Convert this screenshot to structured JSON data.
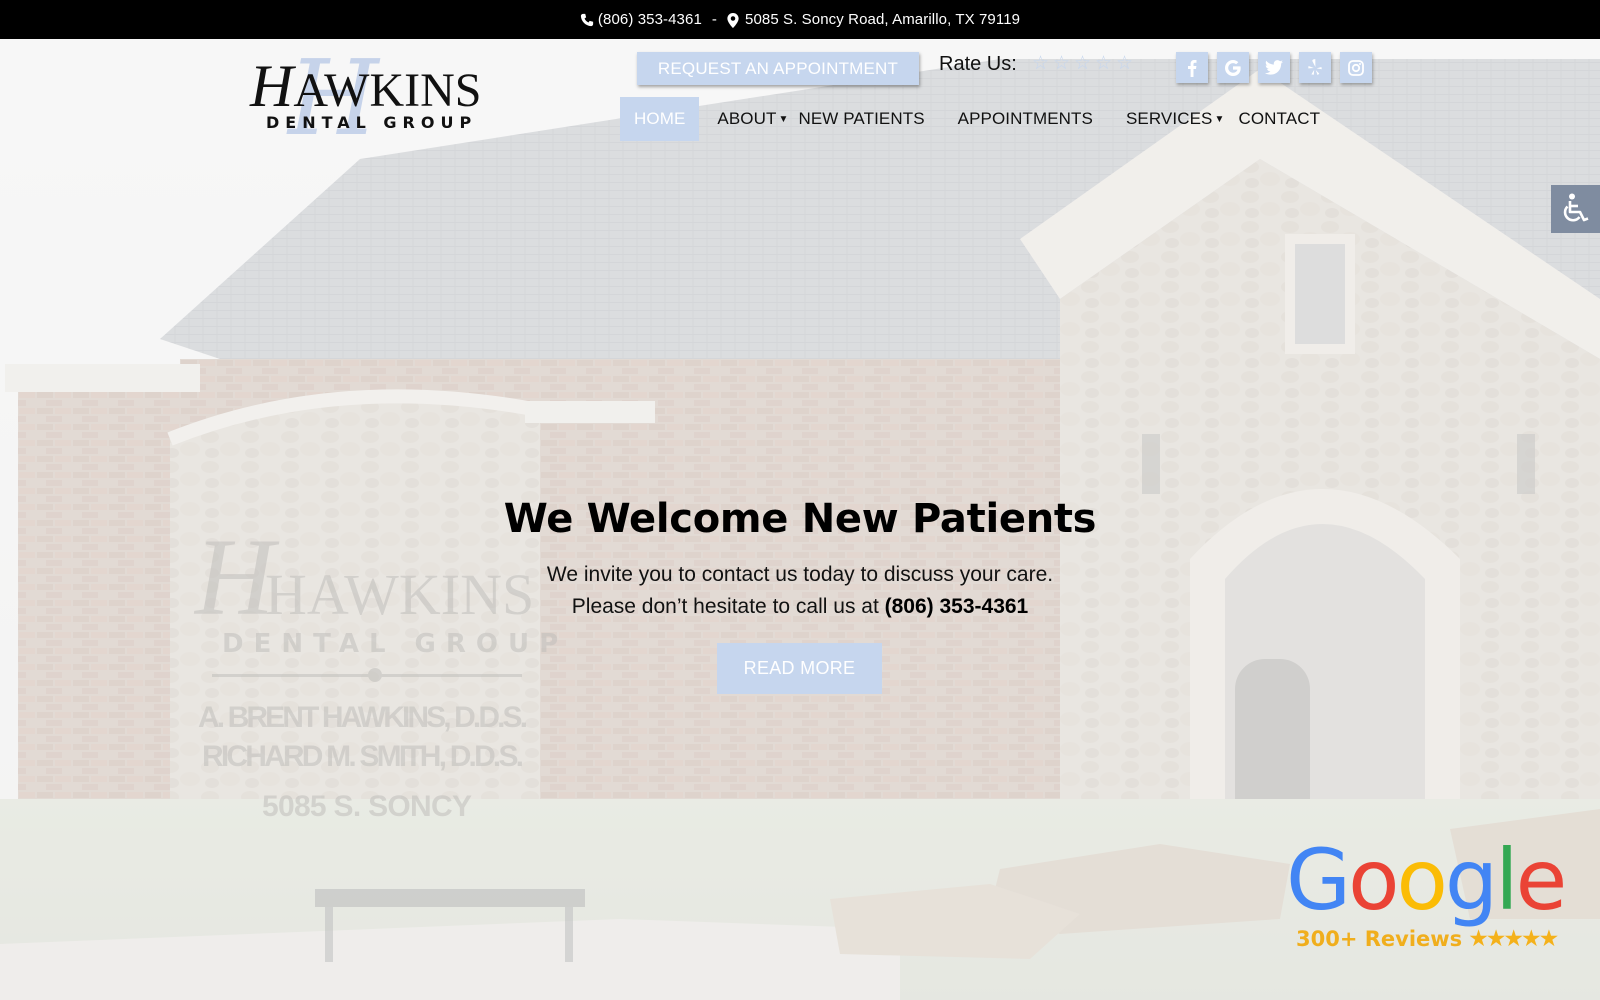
{
  "topbar": {
    "phone_icon": "phone-icon",
    "phone": "(806) 353-4361",
    "separator": "-",
    "location_icon": "map-marker-icon",
    "address": "5085 S. Soncy Road, Amarillo, TX 79119"
  },
  "logo": {
    "initial": "H",
    "name_rest": "AWKINS",
    "tagline": "DENTAL GROUP",
    "monogram": "H"
  },
  "header": {
    "request_button": "REQUEST AN APPOINTMENT",
    "rate_label": "Rate Us:",
    "rate_stars": [
      "☆",
      "☆",
      "☆",
      "☆",
      "☆"
    ],
    "rating_value": 0,
    "social": [
      {
        "name": "facebook",
        "icon": "facebook-icon",
        "glyph": "f"
      },
      {
        "name": "google",
        "icon": "google-icon",
        "glyph": "G"
      },
      {
        "name": "twitter",
        "icon": "twitter-icon",
        "glyph": "t"
      },
      {
        "name": "yelp",
        "icon": "yelp-icon",
        "glyph": "y"
      },
      {
        "name": "instagram",
        "icon": "instagram-icon",
        "glyph": "i"
      }
    ]
  },
  "nav": {
    "items": [
      {
        "label": "HOME",
        "active": true,
        "dropdown": false
      },
      {
        "label": "ABOUT",
        "active": false,
        "dropdown": true
      },
      {
        "label": "NEW PATIENTS",
        "active": false,
        "dropdown": false
      },
      {
        "label": "APPOINTMENTS",
        "active": false,
        "dropdown": false
      },
      {
        "label": "SERVICES",
        "active": false,
        "dropdown": true
      },
      {
        "label": "CONTACT",
        "active": false,
        "dropdown": false
      }
    ],
    "caret": "▼"
  },
  "accessibility": {
    "icon": "wheelchair-icon"
  },
  "hero": {
    "title": "We Welcome New Patients",
    "line1": "We invite you to contact us today to discuss your care.",
    "line2_prefix": "Please don’t hesitate to call us at ",
    "line2_phone": "(806) 353-4361",
    "button": "READ MORE",
    "photo_sign": {
      "brand": "HAWKINS",
      "sub": "DENTAL GROUP",
      "doctor1": "A. BRENT HAWKINS, D.D.S.",
      "doctor2": "RICHARD M. SMITH, D.D.S.",
      "street": "5085 S. SONCY"
    }
  },
  "google_badge": {
    "letters": [
      "G",
      "o",
      "o",
      "g",
      "l",
      "e"
    ],
    "letter_colors": [
      "#4285f4",
      "#ea4335",
      "#fbbc05",
      "#4285f4",
      "#34a853",
      "#ea4335"
    ],
    "reviews": "300+ Reviews",
    "stars": "★★★★★",
    "star_rating": 5
  },
  "colors": {
    "accent": "#c6d6ee",
    "topbar": "#000000",
    "accessibility": "#7f8ca0",
    "reviews_gold": "#f0ae1d"
  }
}
